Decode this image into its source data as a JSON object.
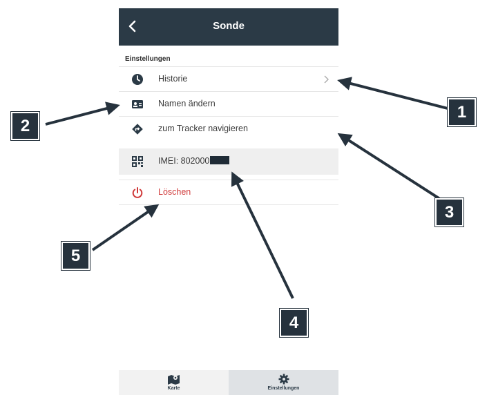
{
  "header": {
    "title": "Sonde"
  },
  "section": {
    "label": "Einstellungen"
  },
  "menu": {
    "history": "Historie",
    "rename": "Namen ändern",
    "navigate": "zum Tracker navigieren",
    "imei_prefix": "IMEI: 802000",
    "delete": "Löschen"
  },
  "tabbar": {
    "map": "Karte",
    "settings": "Einstellungen"
  },
  "callouts": [
    "1",
    "2",
    "3",
    "4",
    "5"
  ],
  "colors": {
    "header": "#2b3a46",
    "delete": "#d03a3a",
    "callout": "#26323d"
  },
  "icons": {
    "back": "chevron-left-icon",
    "history": "clock-icon",
    "rename": "id-card-icon",
    "navigate": "direction-icon",
    "imei": "qr-code-icon",
    "delete": "power-icon",
    "map_tab": "map-icon",
    "settings_tab": "gear-icon"
  }
}
